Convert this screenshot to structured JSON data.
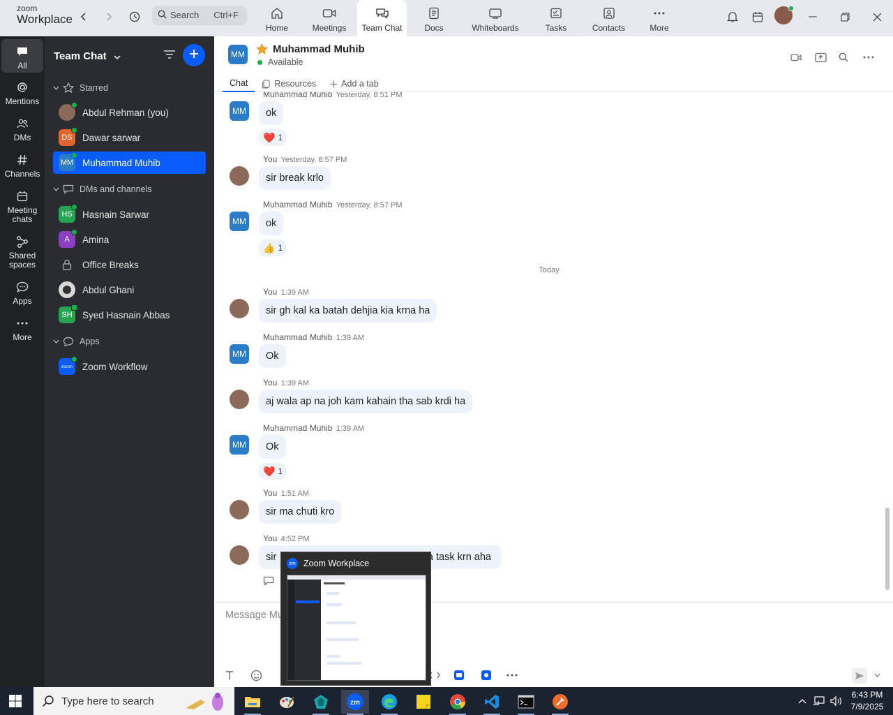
{
  "app": {
    "brand_small": "zoom",
    "brand_large": "Workplace"
  },
  "topbar": {
    "search_label": "Search",
    "search_shortcut": "Ctrl+F",
    "nav": [
      {
        "label": "Home"
      },
      {
        "label": "Meetings"
      },
      {
        "label": "Team Chat"
      },
      {
        "label": "Docs"
      },
      {
        "label": "Whiteboards"
      },
      {
        "label": "Tasks"
      },
      {
        "label": "Contacts"
      },
      {
        "label": "More"
      }
    ]
  },
  "rail": {
    "items": [
      {
        "label": "All"
      },
      {
        "label": "Mentions"
      },
      {
        "label": "DMs"
      },
      {
        "label": "Channels"
      },
      {
        "label": "Meeting chats"
      },
      {
        "label": "Shared spaces"
      },
      {
        "label": "Apps"
      },
      {
        "label": "More"
      }
    ]
  },
  "sidebar": {
    "title": "Team Chat",
    "sections": {
      "starred": "Starred",
      "dms": "DMs and channels",
      "apps": "Apps"
    },
    "starred": [
      {
        "name": "Abdul Rehman (you)",
        "initials": ""
      },
      {
        "name": "Dawar sarwar",
        "initials": "DS"
      },
      {
        "name": "Muhammad Muhib",
        "initials": "MM"
      }
    ],
    "dms": [
      {
        "name": "Hasnain Sarwar",
        "initials": "HS"
      },
      {
        "name": "Amina",
        "initials": "A"
      },
      {
        "name": "Office Breaks",
        "initials": ""
      },
      {
        "name": "Abdul Ghani",
        "initials": ""
      },
      {
        "name": "Syed Hasnain Abbas",
        "initials": "SH"
      }
    ],
    "apps": [
      {
        "name": "Zoom Workflow",
        "initials": "zoom"
      }
    ]
  },
  "chat": {
    "contact_initials": "MM",
    "contact_name": "Muhammad Muhib",
    "status": "Available",
    "tabs": [
      {
        "label": "Chat"
      },
      {
        "label": "Resources"
      },
      {
        "label": "Add a tab"
      }
    ],
    "today_divider": "Today",
    "messages": [
      {
        "sender": "Muhammad Muhib",
        "time": "Yesterday, 8:51 PM",
        "text": "ok",
        "reaction": "❤️",
        "reaction_count": "1"
      },
      {
        "sender": "You",
        "time": "Yesterday, 8:57 PM",
        "text": "sir break krlo"
      },
      {
        "sender": "Muhammad Muhib",
        "time": "Yesterday, 8:57 PM",
        "text": "ok",
        "reaction": "👍",
        "reaction_count": "1"
      },
      {
        "sender": "You",
        "time": "1:39 AM",
        "text": "sir gh kal ka batah dehjia kia krna ha"
      },
      {
        "sender": "Muhammad Muhib",
        "time": "1:39 AM",
        "text": "Ok"
      },
      {
        "sender": "You",
        "time": "1:39 AM",
        "text": "aj wala ap na joh kam kahain tha sab krdi ha"
      },
      {
        "sender": "Muhammad Muhib",
        "time": "1:39 AM",
        "text": "Ok",
        "reaction": "❤️",
        "reaction_count": "1"
      },
      {
        "sender": "You",
        "time": "1:51 AM",
        "text": "sir ma chuti kro"
      },
      {
        "sender": "You",
        "time": "4:52 PM",
        "text_left": "sir",
        "text_right": "a task krn aha"
      }
    ],
    "composer_placeholder": "Message Mu"
  },
  "thumbnail": {
    "title": "Zoom Workplace"
  },
  "taskbar": {
    "search_placeholder": "Type here to search",
    "time": "6:43 PM",
    "date": "7/9/2025"
  },
  "colors": {
    "accent": "#0b5cff",
    "sidebar": "#2a2c31",
    "rail": "#1f2125",
    "bubble": "#eef3fb",
    "online": "#18b04a"
  }
}
